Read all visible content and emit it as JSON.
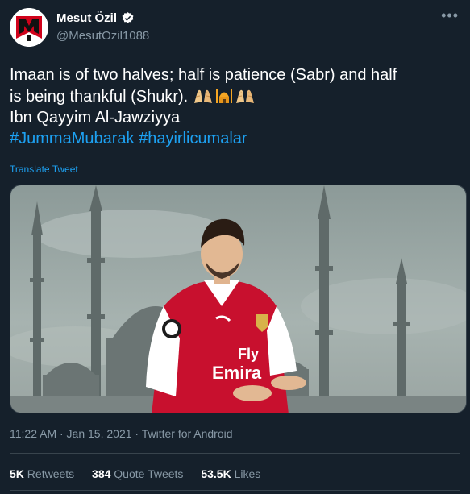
{
  "author": {
    "name": "Mesut Özil",
    "handle": "@MesutOzil1088"
  },
  "tweet": {
    "line1": "Imaan is of two halves;  half is patience (Sabr) and half",
    "line2": "is being thankful (Shukr). ",
    "line3": "Ibn Qayyim Al-Jawziyya",
    "hashtag1": "#JummaMubarak",
    "hashtag2": "#hayirlicumalar",
    "emojis": [
      "praying-hands-icon",
      "mosque-icon",
      "praying-hands-icon"
    ]
  },
  "translate_label": "Translate Tweet",
  "media": {
    "shirt_text_1": "Fly",
    "shirt_text_2": "Emira"
  },
  "timestamp": "11:22 AM · Jan 15, 2021 · Twitter for Android",
  "stats": {
    "retweets_count": "5K",
    "retweets_label": "Retweets",
    "quotes_count": "384",
    "quotes_label": "Quote Tweets",
    "likes_count": "53.5K",
    "likes_label": "Likes"
  },
  "colors": {
    "background": "#15202b",
    "link": "#1da1f2",
    "secondary_text": "#8899a6",
    "divider": "#38444d"
  }
}
